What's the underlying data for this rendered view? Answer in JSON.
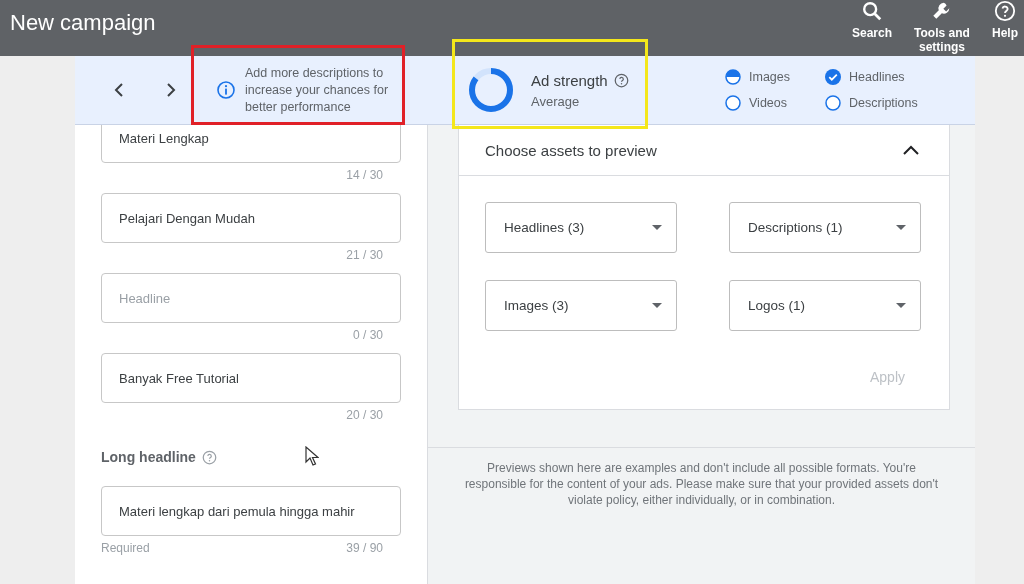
{
  "top_bar": {
    "title": "New campaign",
    "actions": [
      {
        "label": "Search"
      },
      {
        "label": "Tools and settings"
      },
      {
        "label": "Help"
      }
    ]
  },
  "tip": {
    "text": "Add more descriptions to increase your chances for better performance"
  },
  "ad_strength": {
    "title": "Ad strength",
    "rating": "Average",
    "level": 0.85
  },
  "checklist": [
    {
      "label": "Images",
      "kind": "partial"
    },
    {
      "label": "Headlines",
      "kind": "done"
    },
    {
      "label": "Videos",
      "kind": "empty"
    },
    {
      "label": "Descriptions",
      "kind": "empty"
    }
  ],
  "headlines": [
    {
      "value": "Materi Lengkap",
      "counter": "14 / 30"
    },
    {
      "value": "Pelajari Dengan Mudah",
      "counter": "21 / 30"
    },
    {
      "placeholder": "Headline",
      "counter": "0 / 30"
    },
    {
      "value": "Banyak Free Tutorial",
      "counter": "20 / 30"
    }
  ],
  "long_headline": {
    "label": "Long headline",
    "value": "Materi lengkap dari pemula hingga mahir",
    "hint": "Required",
    "counter": "39 / 90"
  },
  "preview": {
    "title": "Choose assets to preview",
    "expanded": true,
    "dropdowns": [
      {
        "label": "Headlines (3)"
      },
      {
        "label": "Descriptions (1)"
      },
      {
        "label": "Images (3)"
      },
      {
        "label": "Logos (1)"
      }
    ],
    "apply": {
      "label": "Apply",
      "disabled": true
    },
    "disclaimer": "Previews shown here are examples and don't include all possible formats. You're responsible for the content of your ads. Please make sure that your provided assets don't violate policy, either individually, or in combination."
  }
}
